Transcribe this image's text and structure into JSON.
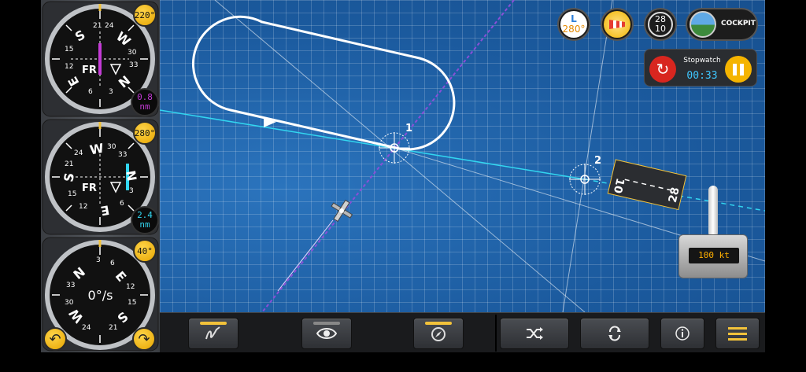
{
  "instruments": {
    "top": {
      "course_badge": "220°",
      "to_from": "FR",
      "distance_value": "0.8",
      "distance_unit": "nm",
      "distance_color": "#c43ad6",
      "needle_color": "#c43ad6",
      "cardinals": {
        "n": "N",
        "e": "E",
        "s": "S",
        "w": "W"
      },
      "numbers": {
        "n3": "3",
        "n6": "6",
        "n12": "12",
        "n15": "15",
        "n21": "21",
        "n24": "24",
        "n30": "30",
        "n33": "33"
      }
    },
    "middle": {
      "course_badge": "280°",
      "to_from": "FR",
      "distance_value": "2.4",
      "distance_unit": "nm",
      "distance_color": "#32d6f0",
      "needle_color": "#32d6f0",
      "cardinals": {
        "n": "N",
        "e": "E",
        "s": "S",
        "w": "W"
      },
      "numbers": {
        "n3": "3",
        "n6": "6",
        "n12": "12",
        "n15": "15",
        "n21": "21",
        "n24": "24",
        "n30": "30",
        "n33": "33"
      }
    },
    "bottom": {
      "course_badge": "40°",
      "turn_rate": "0°/s",
      "cardinals": {
        "n": "N",
        "e": "E",
        "s": "S",
        "w": "W"
      },
      "numbers": {
        "n3": "3",
        "n6": "6",
        "n12": "12",
        "n15": "15",
        "n21": "21",
        "n24": "24",
        "n30": "30",
        "n33": "33"
      }
    }
  },
  "rotate_left_icon": "rotate-left-icon",
  "rotate_right_icon": "rotate-right-icon",
  "top_bar": {
    "wind": {
      "letter": "L",
      "value": "280°"
    },
    "runway": {
      "top": "28",
      "bottom": "10"
    },
    "cockpit_label": "COCKPIT"
  },
  "stopwatch": {
    "title": "Stopwatch",
    "time": "00:33"
  },
  "throttle": {
    "speed": "100 kt"
  },
  "map": {
    "waypoint_1": "1",
    "waypoint_2": "2",
    "runway_end_a": "10",
    "runway_end_b": "28",
    "pattern_color": "#ffffff",
    "radial_color": "#32d6f0",
    "track_color": "#8a4fd8"
  },
  "toolbar": {
    "draw_icon": "draw-icon",
    "view_icon": "eye-icon",
    "compass_icon": "compass-icon",
    "shuffle_icon": "shuffle-icon",
    "refresh_icon": "refresh-icon",
    "info_icon": "info-icon",
    "menu_icon": "menu-icon",
    "accent": "#f2c23a"
  }
}
